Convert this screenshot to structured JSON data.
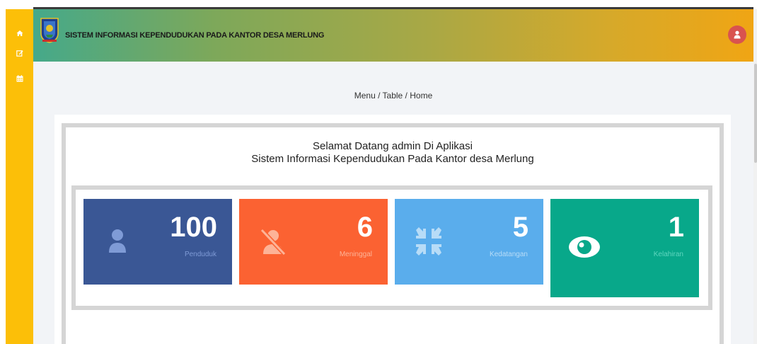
{
  "app": {
    "title": "SISTEM INFORMASI KEPENDUDUKAN PADA KANTOR DESA MERLUNG"
  },
  "sidebar": {
    "items": [
      {
        "icon": "home-icon"
      },
      {
        "icon": "edit-icon"
      },
      {
        "icon": "calendar-icon"
      }
    ]
  },
  "breadcrumb": "Menu / Table / Home",
  "welcome": {
    "line1": "Selamat Datang admin Di Aplikasi",
    "line2": "Sistem Informasi Kependudukan Pada Kantor desa Merlung"
  },
  "stats": [
    {
      "value": "100",
      "label": "Penduduk",
      "color": "#3a5795",
      "label_color": "#7f9bd6",
      "icon": "user-icon"
    },
    {
      "value": "6",
      "label": "Meninggal",
      "color": "#fb6232",
      "label_color": "#fdb397",
      "icon": "user-slash-icon"
    },
    {
      "value": "5",
      "label": "Kedatangan",
      "color": "#5aadec",
      "label_color": "#b7dcf7",
      "icon": "compress-arrows-icon"
    },
    {
      "value": "1",
      "label": "Kelahiran",
      "color": "#08a88a",
      "label_color": "#5fd6bf",
      "icon": "eye-icon"
    }
  ],
  "colors": {
    "sidebar": "#fcbf08",
    "user_button": "#d9534f"
  }
}
